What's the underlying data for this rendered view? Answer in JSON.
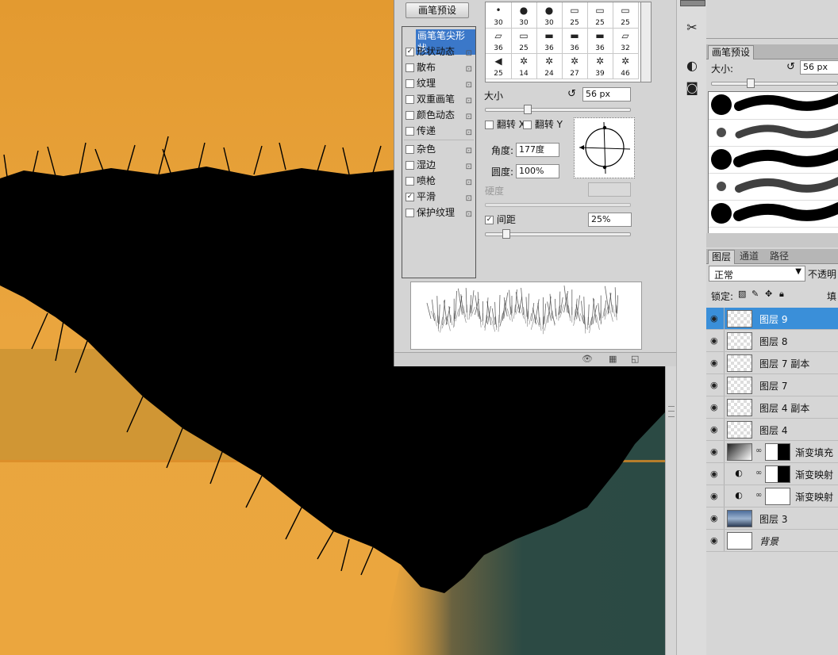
{
  "brush_panel": {
    "preset_button": "画笔预设",
    "options": [
      {
        "label": "画笔笔尖形状",
        "checked": null,
        "selected": true
      },
      {
        "label": "形状动态",
        "checked": true
      },
      {
        "label": "散布",
        "checked": false
      },
      {
        "label": "纹理",
        "checked": false
      },
      {
        "label": "双重画笔",
        "checked": false
      },
      {
        "label": "颜色动态",
        "checked": false
      },
      {
        "label": "传递",
        "checked": false
      },
      {
        "label": "杂色",
        "checked": false
      },
      {
        "label": "湿边",
        "checked": false
      },
      {
        "label": "喷枪",
        "checked": false
      },
      {
        "label": "平滑",
        "checked": true
      },
      {
        "label": "保护纹理",
        "checked": false
      }
    ],
    "tip_sizes": [
      "30",
      "30",
      "30",
      "25",
      "25",
      "25",
      "36",
      "25",
      "36",
      "36",
      "36",
      "32",
      "25",
      "14",
      "24",
      "27",
      "39",
      "46"
    ],
    "size_label": "大小",
    "size_value": "56 px",
    "size_fraction": 0.28,
    "flip_x": "翻转 X",
    "flip_y": "翻转 Y",
    "angle_label": "角度:",
    "angle_value": "177度",
    "roundness_label": "圆度:",
    "roundness_value": "100%",
    "hardness_label": "硬度",
    "spacing_label": "间距",
    "spacing_checked": true,
    "spacing_value": "25%",
    "spacing_fraction": 0.12
  },
  "brush_presets_panel": {
    "tab": "画笔预设",
    "size_label": "大小:",
    "size_value": "56 px",
    "size_fraction": 0.3
  },
  "layers_panel": {
    "tabs": [
      "图层",
      "通道",
      "路径"
    ],
    "blend_mode": "正常",
    "opacity_label": "不透明",
    "lock_label": "锁定:",
    "fill_label": "填",
    "layers": [
      {
        "name": "图层 9",
        "selected": true,
        "kind": "pixel"
      },
      {
        "name": "图层 8",
        "kind": "pixel"
      },
      {
        "name": "图层 7 副本",
        "kind": "pixel"
      },
      {
        "name": "图层 7",
        "kind": "pixel"
      },
      {
        "name": "图层 4 副本",
        "kind": "pixel"
      },
      {
        "name": "图层 4",
        "kind": "pixel"
      },
      {
        "name": "渐变填充",
        "kind": "fill"
      },
      {
        "name": "渐变映射",
        "kind": "adjustment"
      },
      {
        "name": "渐变映射",
        "kind": "adjustment"
      },
      {
        "name": "图层 3",
        "kind": "photo"
      },
      {
        "name": "背景",
        "kind": "background"
      }
    ]
  },
  "colors": {
    "canvas_orange": "#e9a43c",
    "canvas_teal": "#2b4a44",
    "selection_blue": "#3a8fd9"
  }
}
